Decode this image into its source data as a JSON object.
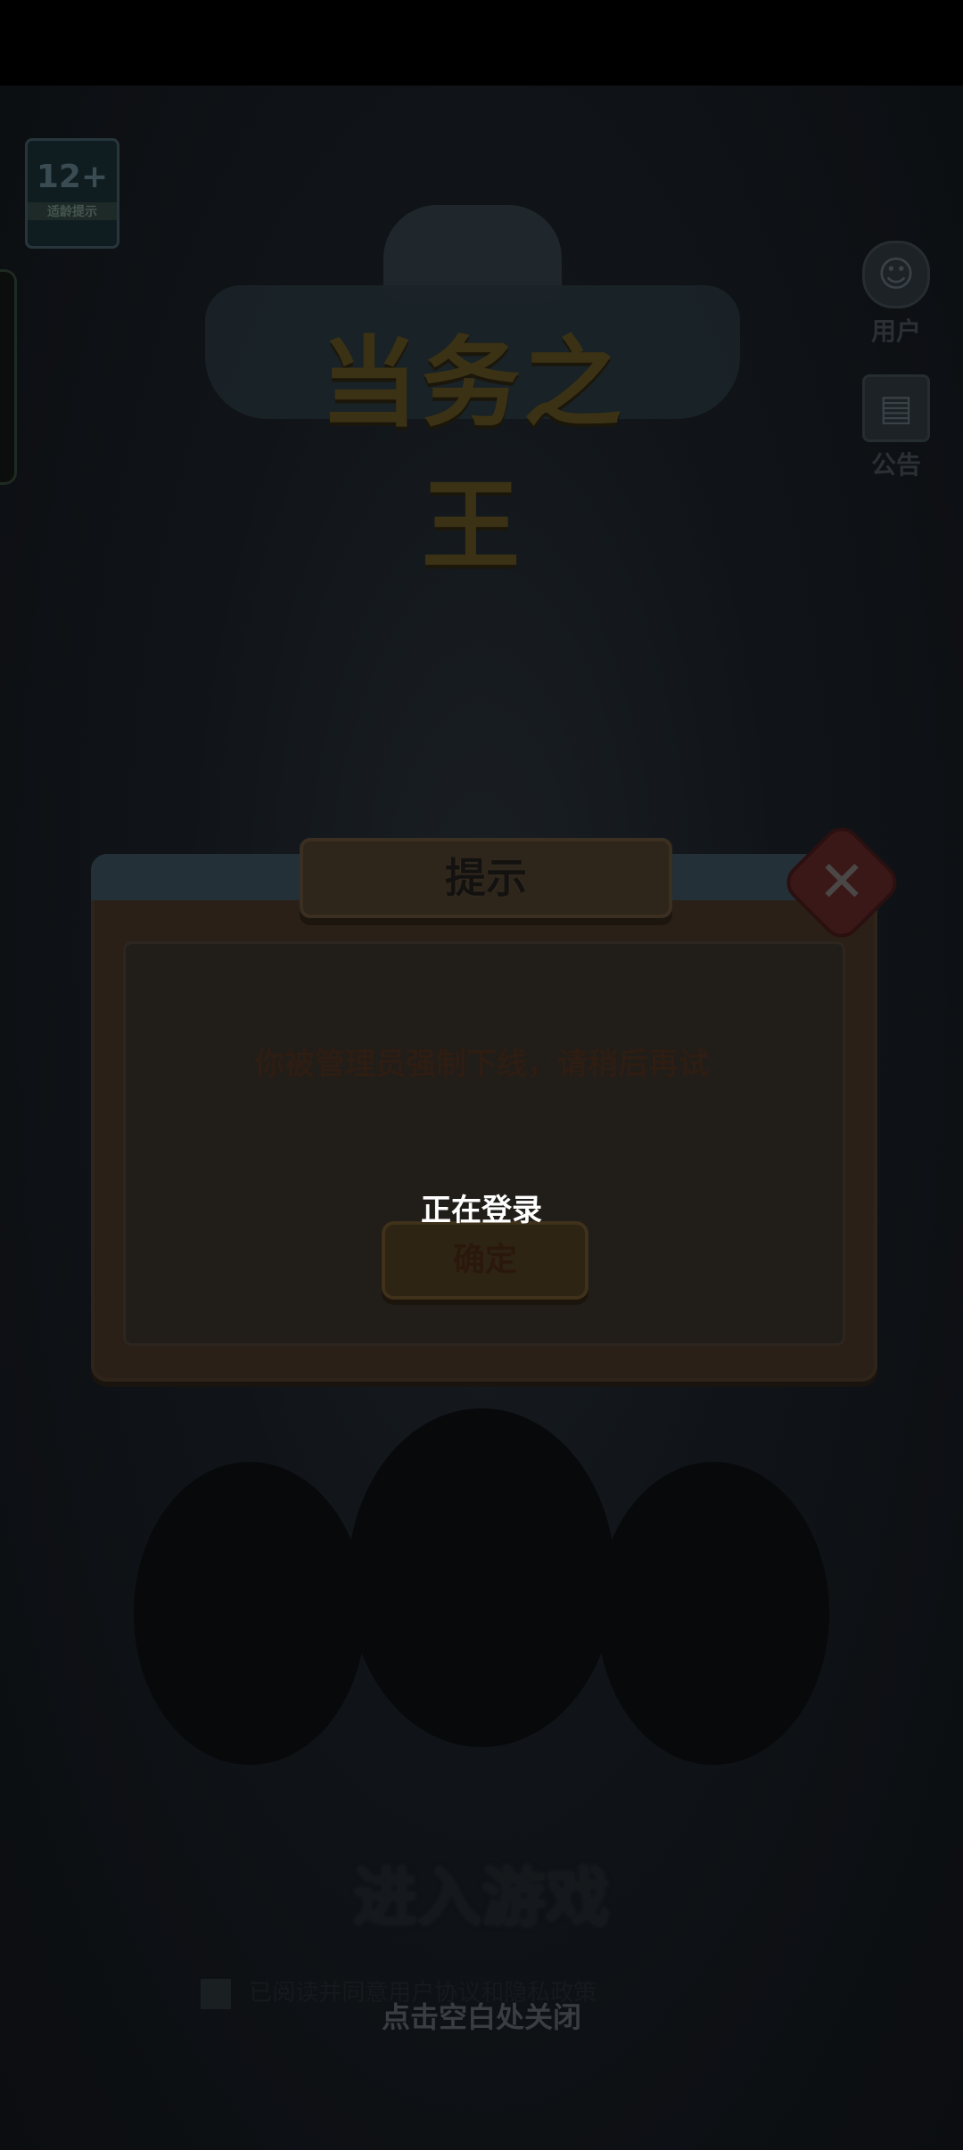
{
  "age_badge": {
    "number": "12+",
    "tag": "适龄提示"
  },
  "logo": {
    "title": "当务之王"
  },
  "right_menu": [
    {
      "icon": "user-icon",
      "glyph": "☺",
      "label": "用户"
    },
    {
      "icon": "notice-icon",
      "glyph": "▤",
      "label": "公告"
    }
  ],
  "enter_game_label": "进入游戏",
  "agreement_text": "已阅读并同意用户协议和隐私政策",
  "dialog": {
    "title": "提示",
    "close_glyph": "✕",
    "message": "你被管理员强制下线，请稍后再试",
    "confirm_label": "确定"
  },
  "toast": "正在登录",
  "tap_close_hint": "点击空白处关闭"
}
